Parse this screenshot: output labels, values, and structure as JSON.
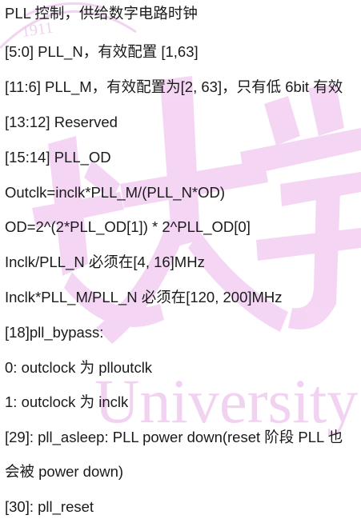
{
  "watermark": {
    "top_text": "1911",
    "bottom_text": "University",
    "color": "#e9bdea"
  },
  "lines": [
    "PLL 控制，供给数字电路时钟",
    "[5:0] PLL_N，有效配置 [1,63]",
    "[11:6] PLL_M，有效配置为[2, 63]，只有低 6bit 有效",
    "[13:12] Reserved",
    "[15:14] PLL_OD",
    "Outclk=inclk*PLL_M/(PLL_N*OD)",
    "OD=2^(2*PLL_OD[1]) * 2^PLL_OD[0]",
    "Inclk/PLL_N 必须在[4, 16]MHz",
    "Inclk*PLL_M/PLL_N 必须在[120, 200]MHz",
    "[18]pll_bypass:",
    "0: outclock 为 plloutclk",
    "1: outclock 为 inclk",
    "[29]: pll_asleep: PLL power down(reset 阶段 PLL 也",
    "会被 power down)",
    "[30]: pll_reset"
  ]
}
